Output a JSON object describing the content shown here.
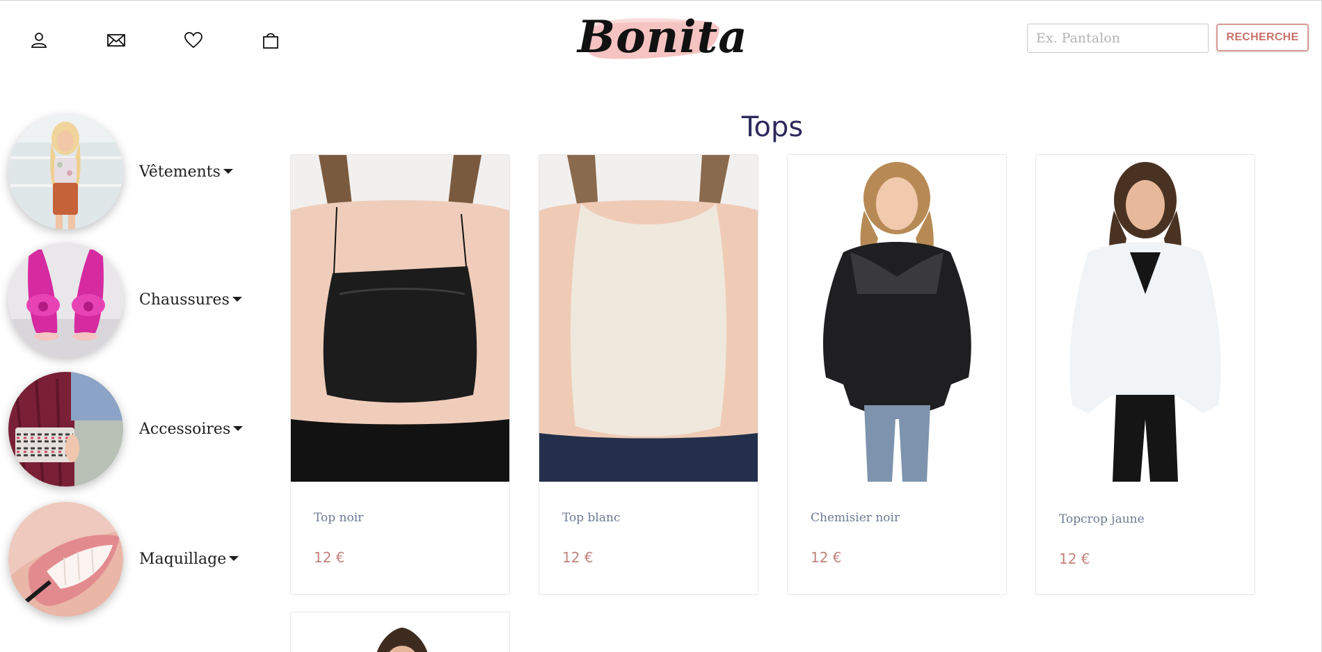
{
  "header": {
    "icons": [
      {
        "name": "user-icon",
        "label": "account"
      },
      {
        "name": "mail-icon",
        "label": "contact"
      },
      {
        "name": "heart-icon",
        "label": "wishlist"
      },
      {
        "name": "bag-icon",
        "label": "cart"
      }
    ],
    "logo_text": "Bonita",
    "search_placeholder": "Ex. Pantalon",
    "search_value": "",
    "search_button": "RECHERCHE"
  },
  "sidebar": {
    "categories": [
      {
        "label": "Vêtements",
        "icon": "chevron-down-icon"
      },
      {
        "label": "Chaussures",
        "icon": "chevron-down-icon"
      },
      {
        "label": "Accessoires",
        "icon": "chevron-down-icon"
      },
      {
        "label": "Maquillage",
        "icon": "chevron-down-icon"
      }
    ]
  },
  "main": {
    "title": "Tops",
    "products": [
      {
        "name": "Top noir",
        "price": "12 €"
      },
      {
        "name": "Top blanc",
        "price": "12 €"
      },
      {
        "name": "Chemisier noir",
        "price": "12 €"
      },
      {
        "name": "Topcrop jaune",
        "price": "12 €"
      }
    ]
  },
  "colors": {
    "accent": "#c8726c",
    "title": "#2e2a5c",
    "product_name": "#6c7a93",
    "price": "#c3827c",
    "logo_brush": "#f3b9b7"
  }
}
